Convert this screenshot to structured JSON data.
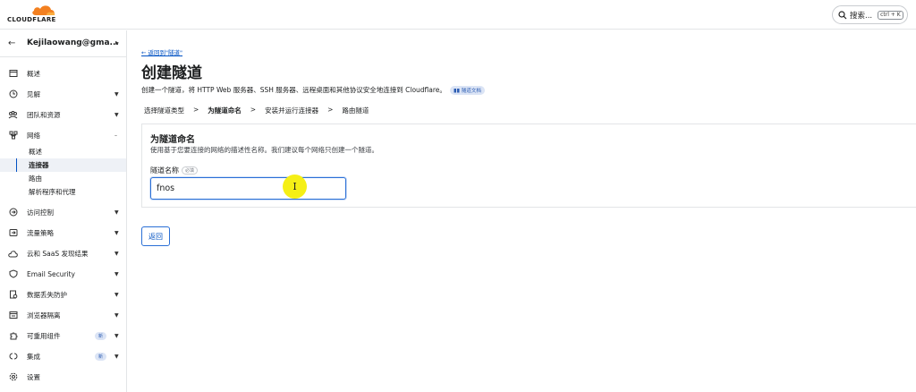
{
  "brand": {
    "logo_text": "CLOUDFLARE",
    "accent": "#f38020"
  },
  "search": {
    "label": "搜索...",
    "shortcut": "ctrl + K"
  },
  "account": {
    "name": "Kejilaowang@gma..."
  },
  "sidebar": {
    "items": [
      {
        "label": "概述",
        "icon": "overview-icon",
        "expandable": false
      },
      {
        "label": "见解",
        "icon": "clock-icon",
        "expandable": true
      },
      {
        "label": "团队和资源",
        "icon": "team-icon",
        "expandable": true
      },
      {
        "label": "网络",
        "icon": "network-icon",
        "expandable": true,
        "expanded": true
      },
      {
        "label": "访问控制",
        "icon": "access-icon",
        "expandable": true
      },
      {
        "label": "流量策略",
        "icon": "traffic-icon",
        "expandable": true
      },
      {
        "label": "云和 SaaS 发现结果",
        "icon": "cloud-icon",
        "expandable": true
      },
      {
        "label": "Email Security",
        "icon": "email-icon",
        "expandable": true
      },
      {
        "label": "数据丢失防护",
        "icon": "dlp-icon",
        "expandable": true
      },
      {
        "label": "浏览器隔离",
        "icon": "browser-icon",
        "expandable": true
      },
      {
        "label": "可重用组件",
        "icon": "puzzle-icon",
        "expandable": true,
        "badge": "新"
      },
      {
        "label": "集成",
        "icon": "integration-icon",
        "expandable": true,
        "badge": "新"
      },
      {
        "label": "设置",
        "icon": "gear-icon",
        "expandable": false
      }
    ],
    "network_sub": [
      {
        "label": "概述"
      },
      {
        "label": "连接器",
        "active": true
      },
      {
        "label": "路由"
      },
      {
        "label": "解析程序和代理"
      }
    ]
  },
  "main": {
    "back_link": "← 返回到\"隧道\"",
    "title": "创建隧道",
    "description": "创建一个隧道，将 HTTP Web 服务器、SSH 服务器、远程桌面和其他协议安全地连接到 Cloudflare。",
    "doc_badge": "隧道文档",
    "steps": [
      "选择隧道类型",
      "为隧道命名",
      "安装并运行连接器",
      "路由隧道"
    ],
    "step_sep": ">",
    "current_step": 1,
    "card": {
      "title": "为隧道命名",
      "subtitle": "使用基于您要连接的网络的描述性名称。我们建议每个网络只创建一个隧道。",
      "field_label": "隧道名称",
      "field_required": "必填",
      "field_value": "fnos"
    },
    "back_button": "返回"
  }
}
